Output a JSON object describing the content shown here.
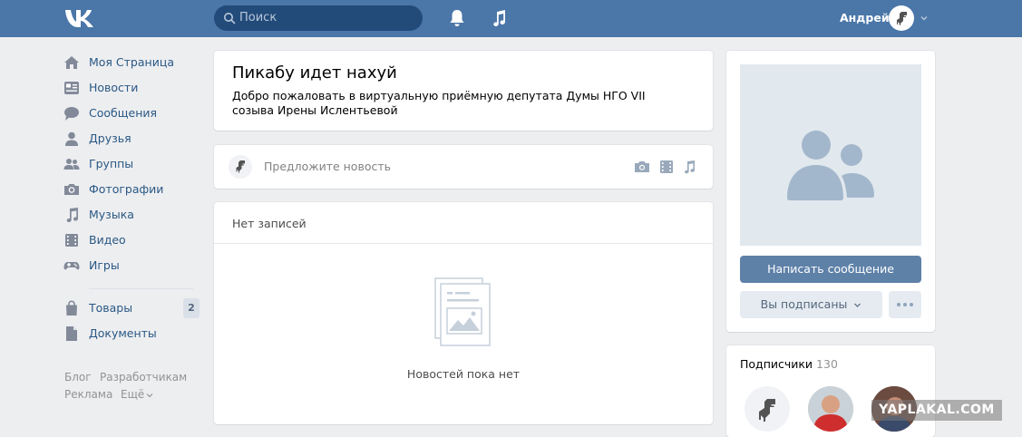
{
  "header": {
    "search_placeholder": "Поиск",
    "user_name": "Андрей"
  },
  "sidebar": {
    "items": [
      {
        "label": "Моя Страница",
        "icon": "home-icon"
      },
      {
        "label": "Новости",
        "icon": "news-icon"
      },
      {
        "label": "Сообщения",
        "icon": "messages-icon"
      },
      {
        "label": "Друзья",
        "icon": "friends-icon"
      },
      {
        "label": "Группы",
        "icon": "groups-icon"
      },
      {
        "label": "Фотографии",
        "icon": "photos-icon"
      },
      {
        "label": "Музыка",
        "icon": "music-icon"
      },
      {
        "label": "Видео",
        "icon": "video-icon"
      },
      {
        "label": "Игры",
        "icon": "games-icon"
      }
    ],
    "extra": [
      {
        "label": "Товары",
        "icon": "bag-icon",
        "badge": "2"
      },
      {
        "label": "Документы",
        "icon": "document-icon"
      }
    ],
    "footer": {
      "blog": "Блог",
      "developers": "Разработчикам",
      "ads": "Реклама",
      "more": "Ещё"
    }
  },
  "page": {
    "title": "Пикабу идет нахуй",
    "status": "Добро пожаловать в виртуальную приёмную депутата Думы НГО VII созыва Ирены Ислентьевой"
  },
  "composer": {
    "placeholder": "Предложите новость"
  },
  "wall": {
    "tab": "Нет записей",
    "empty_text": "Новостей пока нет"
  },
  "group": {
    "write_message": "Написать сообщение",
    "subscribed": "Вы подписаны"
  },
  "subscribers": {
    "title": "Подписчики",
    "count": "130"
  },
  "watermark": "YAPLAKAL.COM",
  "colors": {
    "header": "#4a76a8",
    "link": "#2a5885",
    "button": "#5e81a8",
    "background": "#edeef0"
  }
}
